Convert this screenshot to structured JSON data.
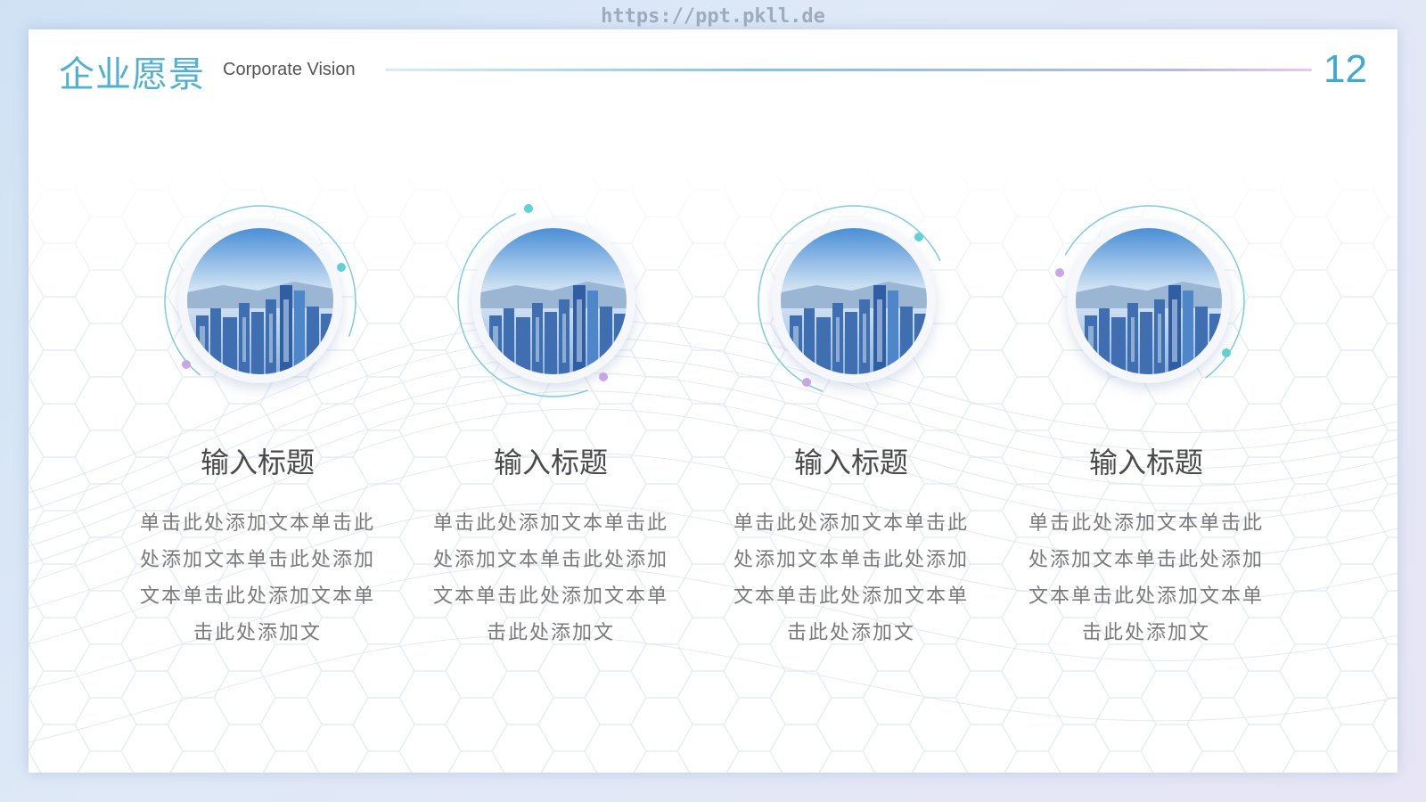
{
  "watermark": "https://ppt.pkll.de",
  "header": {
    "title_cn": "企业愿景",
    "title_en": "Corporate Vision",
    "page_number": "12"
  },
  "cards": [
    {
      "title": "输入标题",
      "body": "单击此处添加文本单击此处添加文本单击此处添加文本单击此处添加文本单击此处添加文"
    },
    {
      "title": "输入标题",
      "body": "单击此处添加文本单击此处添加文本单击此处添加文本单击此处添加文本单击此处添加文"
    },
    {
      "title": "输入标题",
      "body": "单击此处添加文本单击此处添加文本单击此处添加文本单击此处添加文本单击此处添加文"
    },
    {
      "title": "输入标题",
      "body": "单击此处添加文本单击此处添加文本单击此处添加文本单击此处添加文本单击此处添加文"
    }
  ],
  "colors": {
    "accent": "#4fb0d2",
    "teal_dot": "#5fd2d5",
    "purple_dot": "#c9a6e6"
  },
  "icons": [
    "city-skyline-photo",
    "orbit-ring-icon"
  ]
}
